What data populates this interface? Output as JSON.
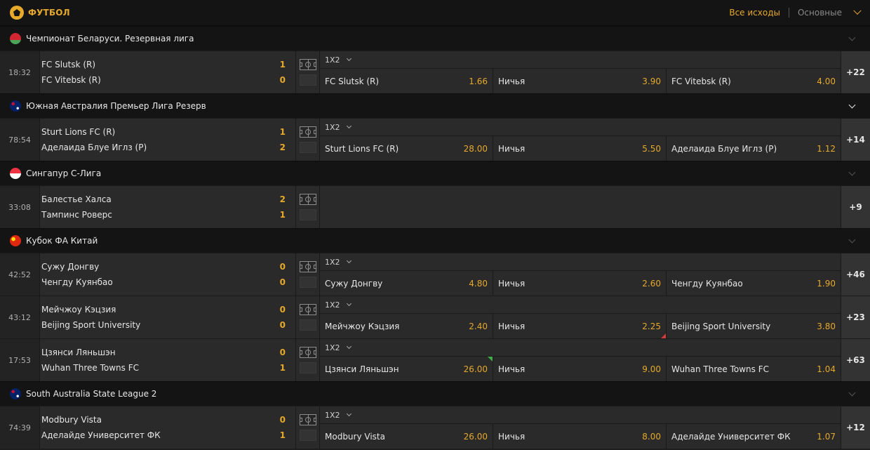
{
  "header": {
    "title": "ФУТБОЛ",
    "all_outcomes": "Все исходы",
    "basic": "Основные"
  },
  "leagues": [
    {
      "name": "Чемпионат Беларуси. Резервная лига",
      "flag": "belarus",
      "matches": [
        {
          "time": "18:32",
          "home": "FC Slutsk (R)",
          "home_score": "1",
          "away": "FC Vitebsk (R)",
          "away_score": "0",
          "market": "1X2",
          "odds": [
            {
              "name": "FC Slutsk (R)",
              "value": "1.66"
            },
            {
              "name": "Ничья",
              "value": "3.90"
            },
            {
              "name": "FC Vitebsk (R)",
              "value": "4.00"
            }
          ],
          "more": "+22"
        }
      ]
    },
    {
      "name": "Южная Австралия Премьер Лига Резерв",
      "flag": "australia",
      "matches": [
        {
          "time": "78:54",
          "home": "Sturt Lions FC (R)",
          "home_score": "1",
          "away": "Аделаида Блуе Иглз (Р)",
          "away_score": "2",
          "market": "1X2",
          "odds": [
            {
              "name": "Sturt Lions FC (R)",
              "value": "28.00"
            },
            {
              "name": "Ничья",
              "value": "5.50"
            },
            {
              "name": "Аделаида Блуе Иглз (Р)",
              "value": "1.12"
            }
          ],
          "more": "+14"
        }
      ]
    },
    {
      "name": "Сингапур С-Лига",
      "flag": "singapore",
      "matches": [
        {
          "time": "33:08",
          "home": "Балестье Халса",
          "home_score": "2",
          "away": "Тампинс Роверс",
          "away_score": "1",
          "market": "",
          "odds": [],
          "more": "+9"
        }
      ]
    },
    {
      "name": "Кубок ФА Китай",
      "flag": "china",
      "matches": [
        {
          "time": "42:52",
          "home": "Сужу Донгву",
          "home_score": "0",
          "away": "Ченгду Куянбао",
          "away_score": "0",
          "market": "1X2",
          "odds": [
            {
              "name": "Сужу Донгву",
              "value": "4.80"
            },
            {
              "name": "Ничья",
              "value": "2.60"
            },
            {
              "name": "Ченгду Куянбао",
              "value": "1.90"
            }
          ],
          "more": "+46"
        },
        {
          "time": "43:12",
          "home": "Мейчжоу Кэцзия",
          "home_score": "0",
          "away": "Beijing Sport University",
          "away_score": "0",
          "market": "1X2",
          "odds": [
            {
              "name": "Мейчжоу Кэцзия",
              "value": "2.40"
            },
            {
              "name": "Ничья",
              "value": "2.25",
              "trend": "down"
            },
            {
              "name": "Beijing Sport University",
              "value": "3.80"
            }
          ],
          "more": "+23"
        },
        {
          "time": "17:53",
          "home": "Цзянси Ляньшэн",
          "home_score": "0",
          "away": "Wuhan Three Towns FC",
          "away_score": "1",
          "market": "1X2",
          "odds": [
            {
              "name": "Цзянси Ляньшэн",
              "value": "26.00",
              "trend": "up"
            },
            {
              "name": "Ничья",
              "value": "9.00"
            },
            {
              "name": "Wuhan Three Towns FC",
              "value": "1.04"
            }
          ],
          "more": "+63"
        }
      ]
    },
    {
      "name": "South Australia State League 2",
      "flag": "australia",
      "matches": [
        {
          "time": "74:39",
          "home": "Modbury Vista",
          "home_score": "0",
          "away": "Аделайде Университет ФК",
          "away_score": "1",
          "market": "1X2",
          "odds": [
            {
              "name": "Modbury Vista",
              "value": "26.00"
            },
            {
              "name": "Ничья",
              "value": "8.00"
            },
            {
              "name": "Аделайде Университет ФК",
              "value": "1.07"
            }
          ],
          "more": "+12"
        }
      ]
    }
  ]
}
